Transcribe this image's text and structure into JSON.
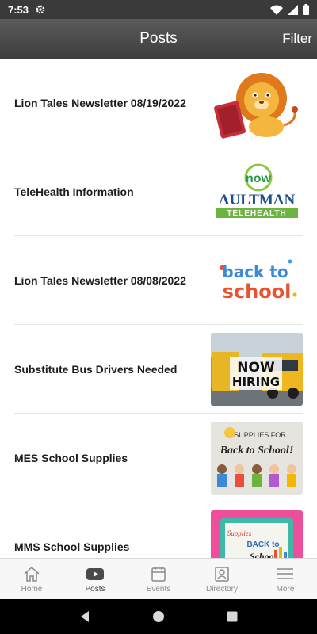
{
  "status": {
    "time": "7:53"
  },
  "header": {
    "title": "Posts",
    "filter_label": "Filter"
  },
  "posts": [
    {
      "title": "Lion Tales Newsletter 08/19/2022",
      "image": "lion-mascot-with-book"
    },
    {
      "title": "TeleHealth Information",
      "image": "aultman-telehealth-logo",
      "logo_now": "now",
      "logo_brand": "AULTMAN",
      "logo_sub": "TELEHEALTH"
    },
    {
      "title": "Lion Tales Newsletter 08/08/2022",
      "image": "back-to-school-text",
      "bts_line1": "back to",
      "bts_line2": "school"
    },
    {
      "title": "Substitute Bus Drivers Needed",
      "image": "school-bus-now-hiring",
      "hiring_line1": "NOW",
      "hiring_line2": "HIRING"
    },
    {
      "title": "MES School Supplies",
      "image": "kids-supplies-back-to-school",
      "supplies_line1": "SUPPLIES FOR",
      "supplies_line2": "Back to School!"
    },
    {
      "title": "MMS School Supplies",
      "image": "supplies-back-to-school-pink",
      "pink_line1": "Supplies",
      "pink_line2": "BACK to",
      "pink_line3": "School"
    }
  ],
  "tabs": [
    {
      "label": "Home",
      "icon": "home-icon"
    },
    {
      "label": "Posts",
      "icon": "youtube-play-icon",
      "active": true
    },
    {
      "label": "Events",
      "icon": "calendar-icon"
    },
    {
      "label": "Directory",
      "icon": "contact-card-icon"
    },
    {
      "label": "More",
      "icon": "hamburger-icon"
    }
  ]
}
